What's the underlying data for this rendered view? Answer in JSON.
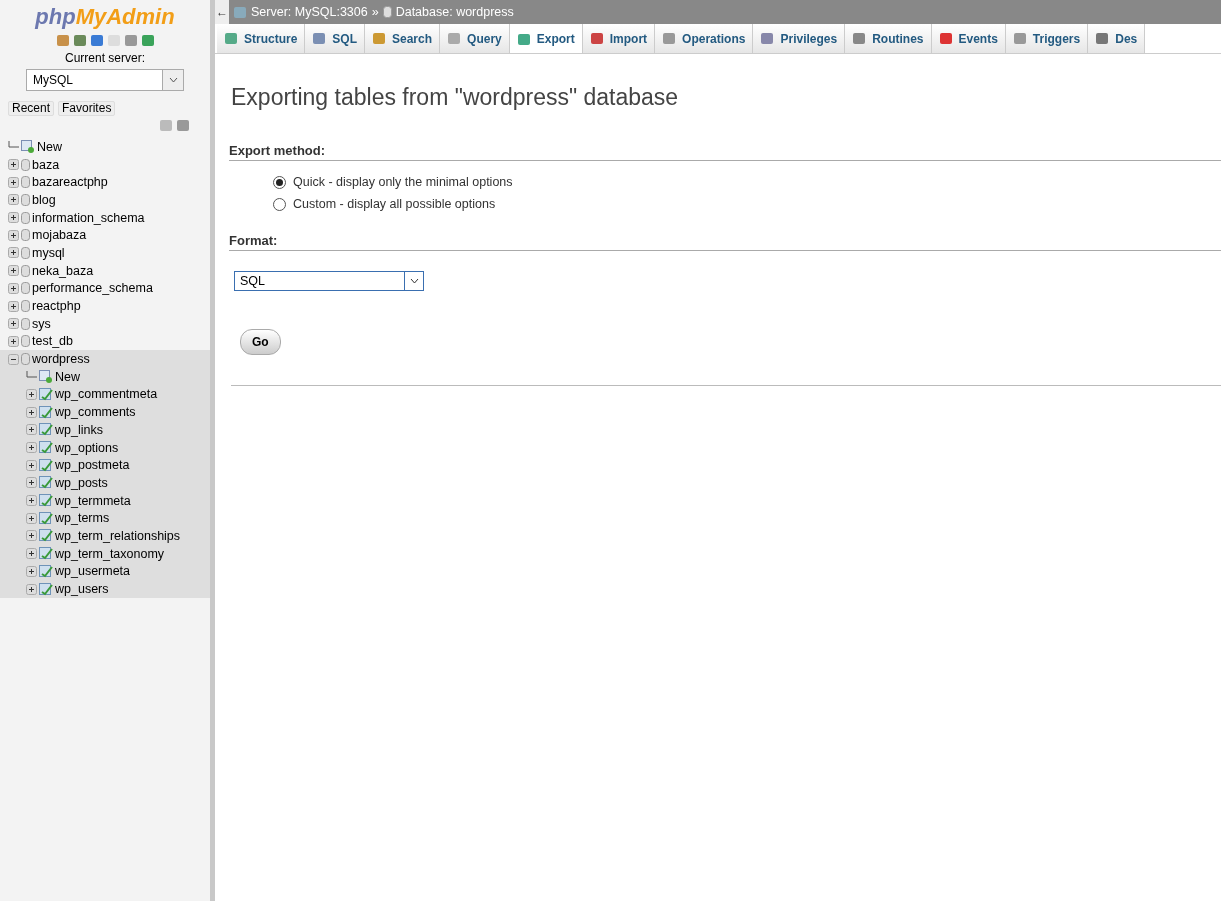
{
  "sidebar": {
    "logo": {
      "php": "php",
      "myadmin": "MyAdmin"
    },
    "current_server_label": "Current server:",
    "server_select": {
      "value": "MySQL"
    },
    "buttons": [
      {
        "label": "Recent"
      },
      {
        "label": "Favorites"
      }
    ],
    "tree": [
      {
        "kind": "new",
        "label": "New"
      },
      {
        "kind": "database",
        "label": "baza",
        "expanded": false
      },
      {
        "kind": "database",
        "label": "bazareactphp",
        "expanded": false
      },
      {
        "kind": "database",
        "label": "blog",
        "expanded": false
      },
      {
        "kind": "database",
        "label": "information_schema",
        "expanded": false
      },
      {
        "kind": "database",
        "label": "mojabaza",
        "expanded": false
      },
      {
        "kind": "database",
        "label": "mysql",
        "expanded": false
      },
      {
        "kind": "database",
        "label": "neka_baza",
        "expanded": false
      },
      {
        "kind": "database",
        "label": "performance_schema",
        "expanded": false
      },
      {
        "kind": "database",
        "label": "reactphp",
        "expanded": false
      },
      {
        "kind": "database",
        "label": "sys",
        "expanded": false
      },
      {
        "kind": "database",
        "label": "test_db",
        "expanded": false
      },
      {
        "kind": "database",
        "label": "wordpress",
        "expanded": true,
        "selected": true,
        "children": [
          {
            "kind": "new",
            "label": "New"
          },
          {
            "kind": "table",
            "label": "wp_commentmeta",
            "expanded": false
          },
          {
            "kind": "table",
            "label": "wp_comments",
            "expanded": false
          },
          {
            "kind": "table",
            "label": "wp_links",
            "expanded": false
          },
          {
            "kind": "table",
            "label": "wp_options",
            "expanded": false
          },
          {
            "kind": "table",
            "label": "wp_postmeta",
            "expanded": false
          },
          {
            "kind": "table",
            "label": "wp_posts",
            "expanded": false
          },
          {
            "kind": "table",
            "label": "wp_termmeta",
            "expanded": false
          },
          {
            "kind": "table",
            "label": "wp_terms",
            "expanded": false
          },
          {
            "kind": "table",
            "label": "wp_term_relationships",
            "expanded": false
          },
          {
            "kind": "table",
            "label": "wp_term_taxonomy",
            "expanded": false
          },
          {
            "kind": "table",
            "label": "wp_usermeta",
            "expanded": false
          },
          {
            "kind": "table",
            "label": "wp_users",
            "expanded": false
          }
        ]
      }
    ]
  },
  "breadcrumb": {
    "back": "←",
    "server": "Server: MySQL:3306",
    "separator": "»",
    "database": "Database: wordpress"
  },
  "tabs": [
    {
      "label": "Structure",
      "selected": false
    },
    {
      "label": "SQL",
      "selected": false
    },
    {
      "label": "Search",
      "selected": false
    },
    {
      "label": "Query",
      "selected": false
    },
    {
      "label": "Export",
      "selected": true
    },
    {
      "label": "Import",
      "selected": false
    },
    {
      "label": "Operations",
      "selected": false
    },
    {
      "label": "Privileges",
      "selected": false
    },
    {
      "label": "Routines",
      "selected": false
    },
    {
      "label": "Events",
      "selected": false
    },
    {
      "label": "Triggers",
      "selected": false
    },
    {
      "label": "Des",
      "selected": false
    }
  ],
  "page_title": "Exporting tables from \"wordpress\" database",
  "export_method": {
    "heading": "Export method:",
    "options": [
      {
        "label": "Quick - display only the minimal options",
        "selected": true
      },
      {
        "label": "Custom - display all possible options",
        "selected": false
      }
    ]
  },
  "format": {
    "heading": "Format:",
    "value": "SQL"
  },
  "go_button": "Go"
}
